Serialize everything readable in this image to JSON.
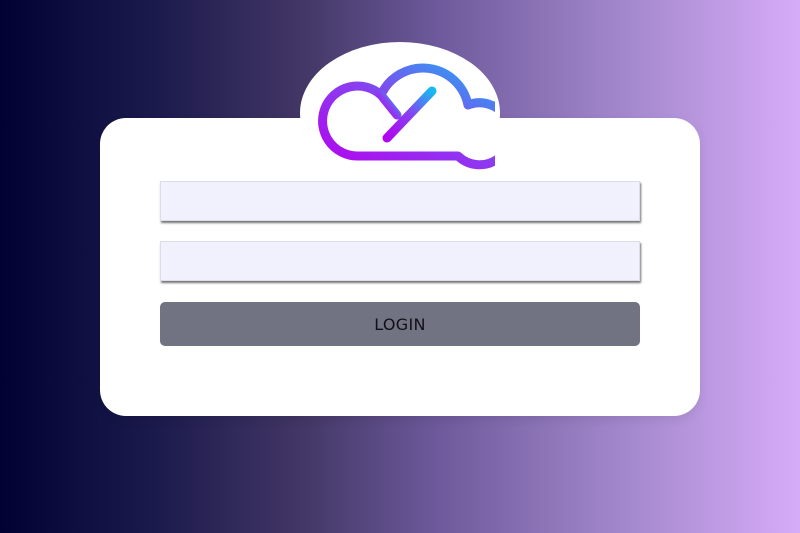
{
  "login_form": {
    "username": {
      "value": "",
      "placeholder": ""
    },
    "password": {
      "value": "",
      "placeholder": ""
    },
    "login_button_label": "LOGIN"
  },
  "logo": {
    "icon": "cloud-icon",
    "gradient_colors": [
      "#b105ee",
      "#8a3ff0",
      "#16b9f2"
    ]
  },
  "colors": {
    "background_start": "#010233",
    "background_end": "#d6acf8",
    "card": "#ffffff",
    "input_fill": "#f1f1fd",
    "button_fill": "#717382"
  }
}
